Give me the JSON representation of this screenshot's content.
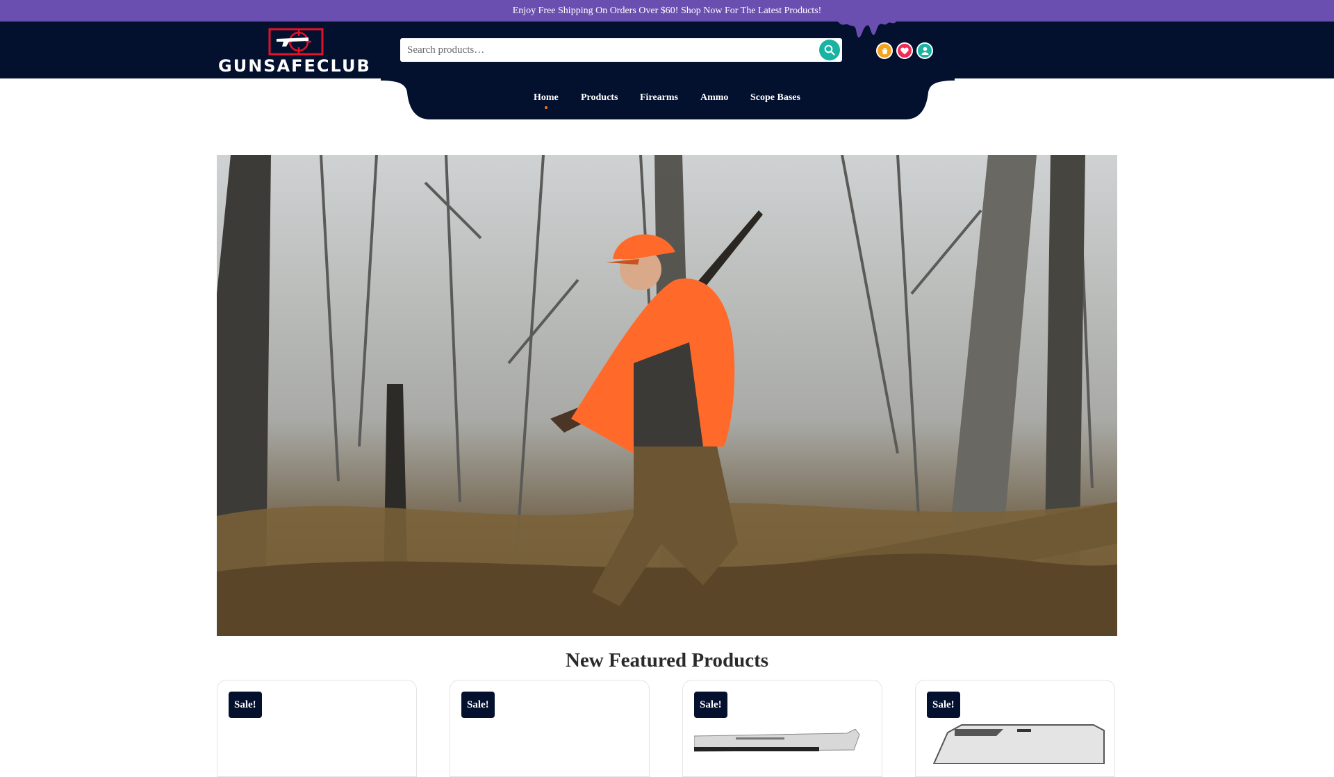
{
  "announcement": "Enjoy Free Shipping On Orders Over $60! Shop Now For The Latest Products!",
  "brand": {
    "name": "GUNSAFECLUB",
    "logo_icon": "pistol-crosshair-logo"
  },
  "search": {
    "placeholder": "Search products…",
    "icon": "search-icon"
  },
  "header_icons": [
    {
      "name": "cart-icon",
      "color": "#f7a21b"
    },
    {
      "name": "heart-icon",
      "color": "#ee2b56"
    },
    {
      "name": "user-icon",
      "color": "#18b3a2"
    }
  ],
  "nav": {
    "items": [
      "Home",
      "Products",
      "Firearms",
      "Ammo",
      "Scope Bases"
    ],
    "active": "Home"
  },
  "hero": {
    "image": "hunter-in-orange-jacket-with-shotgun-in-autumn-forest"
  },
  "featured": {
    "title": "New Featured Products",
    "cards": [
      {
        "badge": "Sale!"
      },
      {
        "badge": "Sale!"
      },
      {
        "badge": "Sale!"
      },
      {
        "badge": "Sale!"
      }
    ]
  },
  "colors": {
    "announce_bg": "#6b4fb0",
    "header_bg": "#03102e",
    "accent_teal": "#18b3a2",
    "accent_orange": "#f07a1b"
  }
}
